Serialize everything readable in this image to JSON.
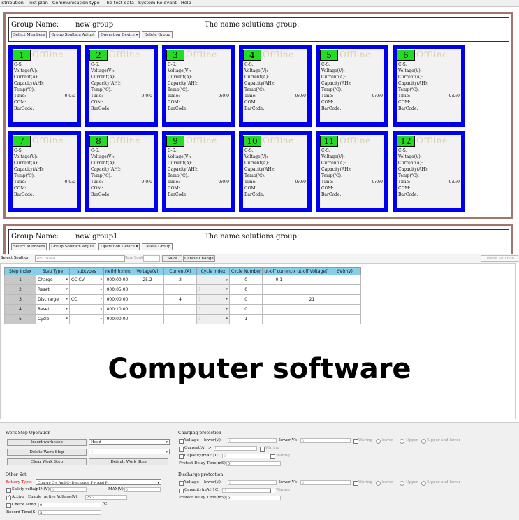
{
  "menu": [
    "istribution",
    "Test plan",
    "Communication type",
    "The test data",
    "System Relevant",
    "Help"
  ],
  "group1": {
    "name_label": "Group Name:",
    "name_value": "new group",
    "solutions_label": "The name solutions group:",
    "buttons": [
      "Select Members",
      "Group Soultion Adjust",
      "Operation Device",
      "Delete Group"
    ]
  },
  "group2": {
    "name_label": "Group Name:",
    "name_value": "new group1",
    "solutions_label": "The name solutions group:",
    "buttons": [
      "Select Members",
      "Group Soultion Adjust",
      "Operation Device",
      "Delete Group"
    ]
  },
  "channel_fields": {
    "cs": "C-S:",
    "voltage": "Voltage(V):",
    "current": "Current(A):",
    "capacity": "Capacity(AH):",
    "temp": "Temp(℃):",
    "time": "Time:",
    "time_value": "0:0:0",
    "com": "COM:",
    "barcode": "BarCode:"
  },
  "channels": [
    {
      "num": "1",
      "status": "Offline"
    },
    {
      "num": "2",
      "status": "Offline"
    },
    {
      "num": "3",
      "status": "Offline"
    },
    {
      "num": "4",
      "status": "Offline"
    },
    {
      "num": "5",
      "status": "Offline"
    },
    {
      "num": "6",
      "status": "Offline"
    },
    {
      "num": "7",
      "status": "Offline"
    },
    {
      "num": "8",
      "status": "Offline"
    },
    {
      "num": "9",
      "status": "Offline"
    },
    {
      "num": "10",
      "status": "Offline"
    },
    {
      "num": "11",
      "status": "Offline"
    },
    {
      "num": "12",
      "status": "Offline"
    }
  ],
  "solution_bar": {
    "select_label": "Select Soultion",
    "select_value": "45C2A04A",
    "new_label": "New Soultion",
    "save": "Save",
    "cancel": "Cancle Change",
    "delete": "Delete Soultion"
  },
  "steps_table": {
    "headers": [
      "Step Index",
      "Step Type",
      "subtypes",
      "ne(hhh:mm:s",
      "Voltage(V)",
      "Current(A)",
      "Cycle Index",
      "Cycle Number",
      "ut-off current(A",
      "ut-off Voltage(V",
      "ΔV(mV)"
    ],
    "rows": [
      {
        "index": "1",
        "type": "Charge",
        "subtype": "CC-CV",
        "time": "000:00:00",
        "voltage": "25.2",
        "current": "2",
        "cycle_index": "",
        "cycle_number": "0",
        "cutoff_current": "0.1",
        "cutoff_voltage": "",
        "dv": ""
      },
      {
        "index": "2",
        "type": "Reset",
        "subtype": "",
        "time": "000:05:00",
        "voltage": "",
        "current": "",
        "cycle_index": "1",
        "cycle_number": "0",
        "cutoff_current": "",
        "cutoff_voltage": "",
        "dv": ""
      },
      {
        "index": "3",
        "type": "Discharge",
        "subtype": "CC",
        "time": "000:00:00",
        "voltage": "",
        "current": "4",
        "cycle_index": "1",
        "cycle_number": "0",
        "cutoff_current": "",
        "cutoff_voltage": "21",
        "dv": ""
      },
      {
        "index": "4",
        "type": "Reset",
        "subtype": "",
        "time": "000:10:00",
        "voltage": "",
        "current": "",
        "cycle_index": "1",
        "cycle_number": "0",
        "cutoff_current": "",
        "cutoff_voltage": "",
        "dv": ""
      },
      {
        "index": "5",
        "type": "Cycle",
        "subtype": "",
        "time": "000:00:00",
        "voltage": "",
        "current": "",
        "cycle_index": "1",
        "cycle_number": "1",
        "cutoff_current": "",
        "cutoff_voltage": "",
        "dv": ""
      }
    ]
  },
  "watermark": "Computer software",
  "work_step": {
    "title": "Work Step Operation",
    "insert": "Insert work step",
    "delete": "Delete Work Step",
    "clear": "Clear Work Step",
    "default": "Default Work Step",
    "position_value": "Head",
    "step_value": "1"
  },
  "other_set": {
    "title": "Other Set",
    "battery_type_label": "Battery Type:",
    "battery_type_value": "Charge C+ And C-,Discharge P+ And P-",
    "safety_label": "Safety voltag",
    "min_label": "MIN(V):",
    "min_value": "0",
    "max_label": "MAX(V):",
    "max_value": "0",
    "active_label": "Active",
    "enable_label": "Enable",
    "active_voltage_label": "active Voltage(V):",
    "active_voltage_value": "25.2",
    "check_temp_label": "Check Temp",
    "check_temp_value": "0",
    "temp_unit": "℃",
    "record_label": "Record Time(S)",
    "record_value": "5"
  },
  "charging": {
    "title": "Charging protection",
    "voltage_label": "Voltage",
    "lower_label": "lower(V):",
    "lower_value": "0",
    "lower2_label": "lower(V):",
    "lower2_value": "0",
    "current_label": "Current(A)",
    "current_op": ">:",
    "current_value": "0",
    "capacity_label": "Capacity(mAH)",
    "capacity_op": "C:",
    "capacity_value": "0",
    "delay_label": "Protect Delay Time(mS)",
    "delay_value": "0",
    "waring": "Waring",
    "lower_opt": "lower",
    "upper_opt": "Upper",
    "upper_lower_opt": "Upper and lower"
  },
  "discharge": {
    "title": "Discharge protection",
    "voltage_label": "Voltage",
    "lower_label": "lower(V):",
    "lower_value": "0",
    "lower2_label": "lower(V):",
    "lower2_value": "0",
    "capacity_label": "Capacity(mAH)",
    "capacity_op": "C:",
    "capacity_value": "0",
    "delay_label": "Protect Delay Time(mS)",
    "delay_value": "0",
    "waring": "Waring",
    "lower_opt": "lower",
    "upper_opt": "Upper",
    "upper_lower_opt": "Upper and lower"
  },
  "colors": {
    "frame_border": "#a3746b",
    "channel_bg": "#0000ee",
    "channel_num_bg": "#22dd22",
    "table_header": "#87cfe8"
  }
}
